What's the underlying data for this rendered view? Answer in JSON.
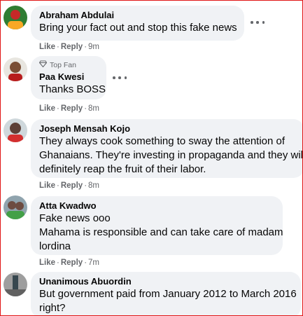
{
  "comments": [
    {
      "name": "Abraham Abdulai",
      "lines": [
        "Bring your fact out and stop this fake news"
      ],
      "like_label": "Like",
      "reply_label": "Reply",
      "time": "9m",
      "avatar_colors": [
        "#2f7d32",
        "#c62828",
        "#f9a825"
      ]
    },
    {
      "badge": "Top Fan",
      "name": "Paa Kwesi",
      "lines": [
        "Thanks BOSS"
      ],
      "like_label": "Like",
      "reply_label": "Reply",
      "time": "8m",
      "avatar_colors": [
        "#e8e6e0",
        "#7a4e35",
        "#b71c1c"
      ]
    },
    {
      "name": "Joseph Mensah Kojo",
      "lines": [
        "They always cook something to sway the attention of",
        "Ghanaians. They're investing in propaganda and they will",
        "definitely reap the fruit of their labor."
      ],
      "like_label": "Like",
      "reply_label": "Reply",
      "time": "8m",
      "avatar_colors": [
        "#cfd8dc",
        "#5d4037",
        "#d32f2f"
      ]
    },
    {
      "name": "Atta Kwadwo",
      "lines": [
        "Fake news ooo",
        "Mahama is responsible and can take care of madam",
        "lordina"
      ],
      "like_label": "Like",
      "reply_label": "Reply",
      "time": "7m",
      "avatar_colors": [
        "#90a4ae",
        "#6d4c41",
        "#43a047"
      ]
    },
    {
      "name": "Unanimous Abuordin",
      "lines": [
        "But government paid from January 2012 to March 2016",
        "right?"
      ],
      "avatar_colors": [
        "#9e9e9e",
        "#37474f",
        "#616161"
      ]
    }
  ],
  "colors": {
    "bubble": "#f0f2f5",
    "name_text": "#050505",
    "meta_text": "#65676b",
    "frame_border": "#e01515"
  }
}
